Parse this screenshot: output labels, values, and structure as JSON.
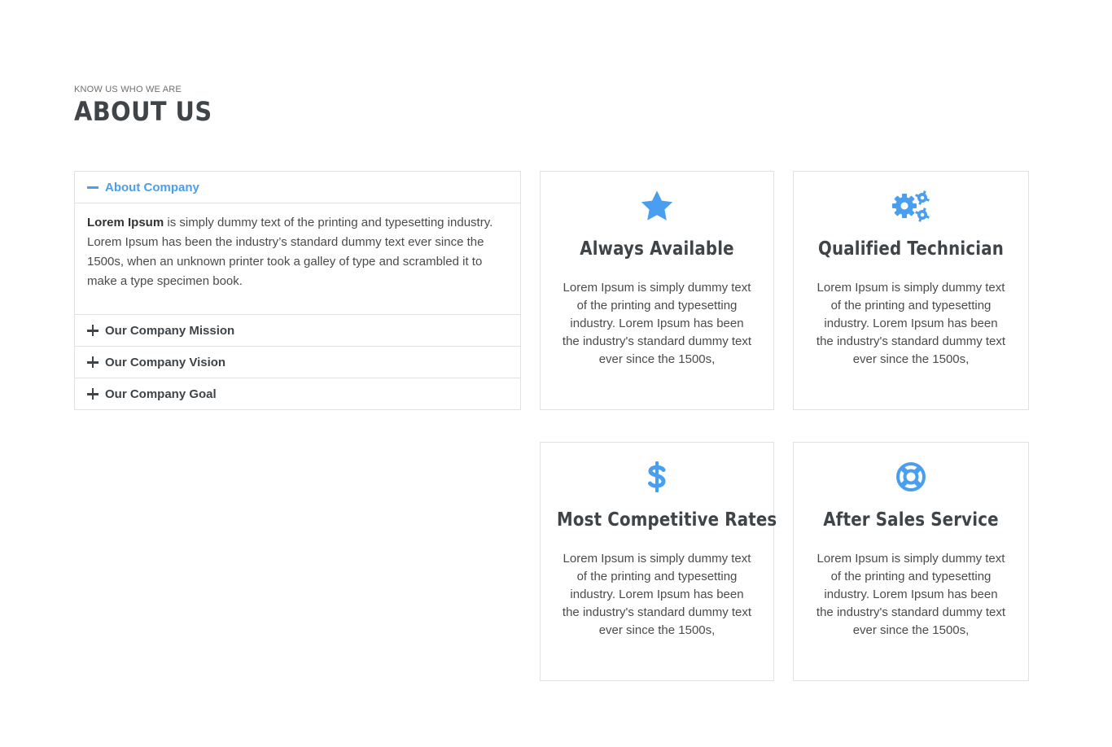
{
  "section": {
    "kicker": "KNOW US WHO WE ARE",
    "title": "ABOUT US"
  },
  "accordion": {
    "items": [
      {
        "label": "About Company",
        "open": true,
        "body_bold": "Lorem Ipsum",
        "body_text": " is simply dummy text of the printing and typesetting industry. Lorem Ipsum has been the industry’s standard dummy text ever since the 1500s, when an unknown printer took a galley of type and scrambled it to make a type specimen book."
      },
      {
        "label": "Our Company Mission",
        "open": false
      },
      {
        "label": "Our Company Vision",
        "open": false
      },
      {
        "label": "Our Company Goal",
        "open": false
      }
    ]
  },
  "features": [
    {
      "icon": "star-icon",
      "title": "Always Available",
      "text": "Lorem Ipsum is simply dummy text of the printing and typesetting industry. Lorem Ipsum has been the industry's standard dummy text ever since the 1500s,"
    },
    {
      "icon": "gears-icon",
      "title": "Qualified Technician",
      "text": "Lorem Ipsum is simply dummy text of the printing and typesetting industry. Lorem Ipsum has been the industry's standard dummy text ever since the 1500s,"
    },
    {
      "icon": "dollar-icon",
      "title": "Most Competitive Rates",
      "text": "Lorem Ipsum is simply dummy text of the printing and typesetting industry. Lorem Ipsum has been the industry's standard dummy text ever since the 1500s,"
    },
    {
      "icon": "life-ring-icon",
      "title": "After Sales Service",
      "text": "Lorem Ipsum is simply dummy text of the printing and typesetting industry. Lorem Ipsum has been the industry's standard dummy text ever since the 1500s,"
    }
  ],
  "colors": {
    "accent": "#4a9ef0",
    "heading": "#3f4449",
    "border": "#e1e1e1"
  }
}
